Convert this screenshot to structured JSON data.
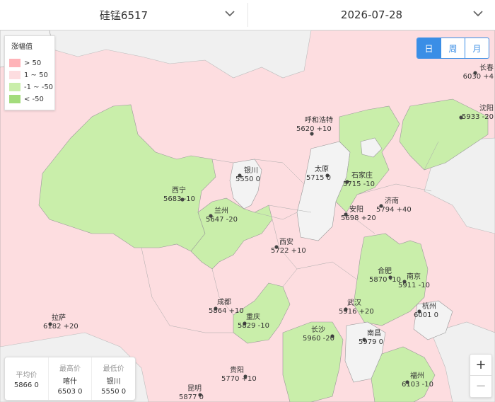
{
  "header": {
    "product": "硅锰6517",
    "date": "2026-07-28"
  },
  "legend": {
    "title": "涨幅值",
    "items": [
      {
        "label": "> 50",
        "color": "#ffb3b8"
      },
      {
        "label": "1 ~ 50",
        "color": "#fddde0"
      },
      {
        "label": "-1 ~ -50",
        "color": "#c9eeaa"
      },
      {
        "label": "< -50",
        "color": "#a3dc7c"
      }
    ]
  },
  "tabs": {
    "items": [
      "日",
      "周",
      "月"
    ],
    "active": "日"
  },
  "stats": {
    "avg_label": "平均价",
    "avg_value": "5866 0",
    "high_label": "最高价",
    "high_city": "喀什",
    "high_value": "6503 0",
    "low_label": "最低价",
    "low_city": "银川",
    "low_value": "5550 0"
  },
  "zoom": {
    "in": "+",
    "out": "−"
  },
  "cities": [
    {
      "name": "长春",
      "value": "6030 +4",
      "change": 4
    },
    {
      "name": "沈阳",
      "value": "5933 -20",
      "change": -20
    },
    {
      "name": "呼和浩特",
      "value": "5620 +10",
      "change": 10
    },
    {
      "name": "银川",
      "value": "5550 0",
      "change": 0
    },
    {
      "name": "太原",
      "value": "5715 0",
      "change": 0
    },
    {
      "name": "石家庄",
      "value": "5715 -10",
      "change": -10
    },
    {
      "name": "西宁",
      "value": "5683 -10",
      "change": -10
    },
    {
      "name": "济南",
      "value": "5794 +40",
      "change": 40
    },
    {
      "name": "兰州",
      "value": "5647 -20",
      "change": -20
    },
    {
      "name": "安阳",
      "value": "5698 +20",
      "change": 20
    },
    {
      "name": "西安",
      "value": "5722 +10",
      "change": 10
    },
    {
      "name": "合肥",
      "value": "5870 -10",
      "change": -10
    },
    {
      "name": "南京",
      "value": "5911 -10",
      "change": -10
    },
    {
      "name": "成都",
      "value": "5864 +10",
      "change": 10
    },
    {
      "name": "武汉",
      "value": "5916 +20",
      "change": 20
    },
    {
      "name": "杭州",
      "value": "6001 0",
      "change": 0
    },
    {
      "name": "拉萨",
      "value": "6182 +20",
      "change": 20
    },
    {
      "name": "重庆",
      "value": "5829 -10",
      "change": -10
    },
    {
      "name": "长沙",
      "value": "5960 -20",
      "change": -20
    },
    {
      "name": "南昌",
      "value": "5979 0",
      "change": 0
    },
    {
      "name": "贵阳",
      "value": "5770 +10",
      "change": 10
    },
    {
      "name": "福州",
      "value": "6103 -10",
      "change": -10
    },
    {
      "name": "昆明",
      "value": "5877 0",
      "change": 0
    }
  ]
}
